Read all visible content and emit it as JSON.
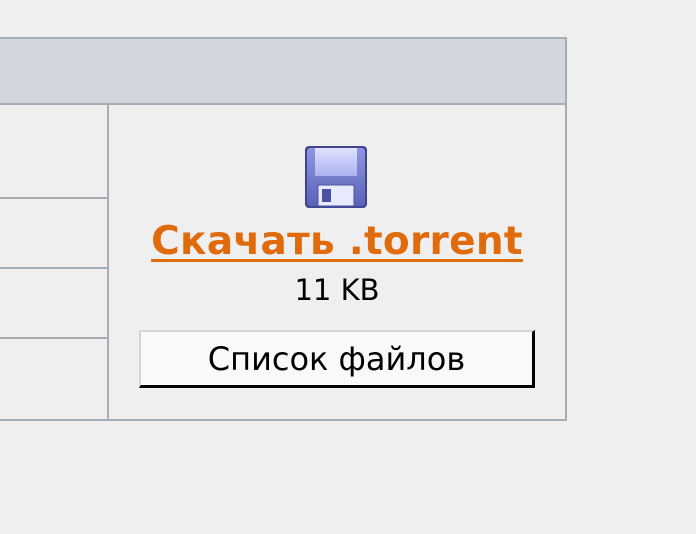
{
  "torrent": {
    "download_label": "Скачать .torrent",
    "size": "11 KB",
    "file_list_label": "Список файлов",
    "icon": "floppy-disk-icon"
  },
  "colors": {
    "link": "#e06b0c",
    "header_bg": "#d2d7de",
    "border": "#a6adb4",
    "page_bg": "#efefef"
  }
}
